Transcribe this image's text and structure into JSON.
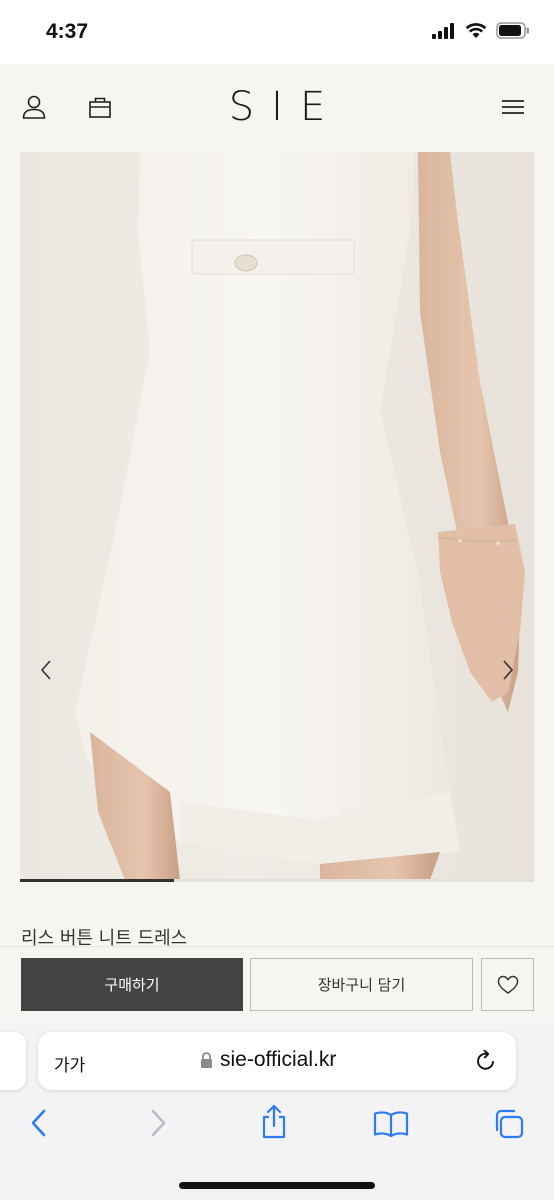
{
  "status_bar": {
    "time": "4:37"
  },
  "header": {
    "logo": "SIE"
  },
  "product": {
    "title": "리스 버튼 니트 드레스",
    "image_slide_progress": 0.3
  },
  "actions": {
    "buy_label": "구매하기",
    "cart_label": "장바구니 담기"
  },
  "browser": {
    "aa_label": "가가",
    "url": "sie-official.kr"
  },
  "colors": {
    "buy_button_bg": "#444444",
    "safari_blue": "#2f7bf6",
    "background": "#f6f5f1"
  },
  "icons": [
    "user-icon",
    "shopping-bag-icon",
    "menu-icon",
    "chevron-left-icon",
    "chevron-right-icon",
    "heart-icon",
    "lock-icon",
    "reload-icon",
    "share-icon",
    "bookmarks-icon",
    "tabs-icon"
  ]
}
